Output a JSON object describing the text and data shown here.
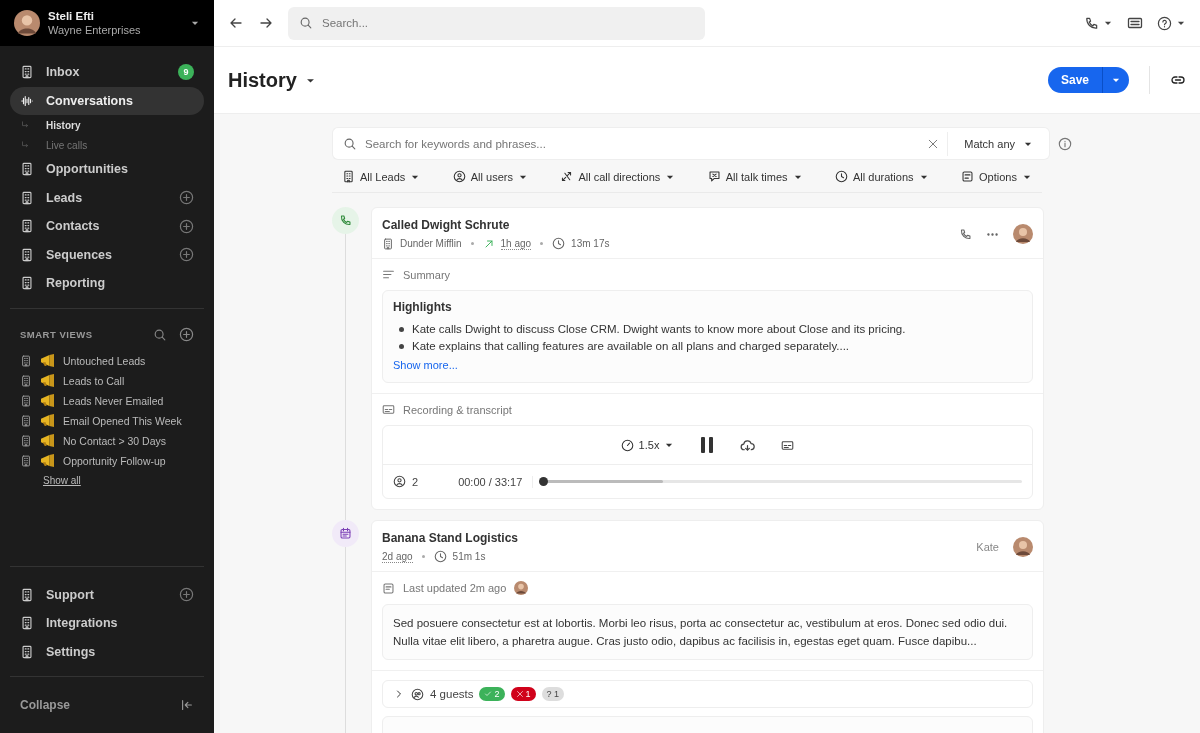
{
  "account": {
    "name": "Steli Efti",
    "company": "Wayne Enterprises"
  },
  "nav": [
    {
      "label": "Inbox",
      "kind": "building",
      "badge": "9",
      "add": false,
      "selected": false
    },
    {
      "label": "Conversations",
      "kind": "wave",
      "add": false,
      "selected": true,
      "children": [
        {
          "label": "History",
          "selected": true
        },
        {
          "label": "Live calls",
          "selected": false
        }
      ]
    },
    {
      "label": "Opportunities",
      "kind": "building",
      "add": false,
      "selected": false
    },
    {
      "label": "Leads",
      "kind": "building",
      "add": true,
      "selected": false
    },
    {
      "label": "Contacts",
      "kind": "building",
      "add": true,
      "selected": false
    },
    {
      "label": "Sequences",
      "kind": "building",
      "add": true,
      "selected": false
    },
    {
      "label": "Reporting",
      "kind": "building",
      "add": false,
      "selected": false
    }
  ],
  "smart_views": {
    "title": "SMART VIEWS",
    "items": [
      "Untouched Leads",
      "Leads to Call",
      "Leads Never Emailed",
      "Email Opened This Week",
      "No Contact > 30 Days",
      "Opportunity Follow-up"
    ],
    "show_all": "Show all"
  },
  "bottom_nav": [
    {
      "label": "Support",
      "add": true
    },
    {
      "label": "Integrations",
      "add": false
    },
    {
      "label": "Settings",
      "add": false
    }
  ],
  "collapse": "Collapse",
  "topbar": {
    "search_placeholder": "Search..."
  },
  "page": {
    "title": "History",
    "save": "Save"
  },
  "filter": {
    "placeholder": "Search for keywords and phrases...",
    "match": "Match any",
    "chips": [
      {
        "kind": "leads",
        "label": "All Leads"
      },
      {
        "kind": "users",
        "label": "All users"
      },
      {
        "kind": "directions",
        "label": "All call directions"
      },
      {
        "kind": "talk_times",
        "label": "All talk times"
      },
      {
        "kind": "durations",
        "label": "All durations"
      },
      {
        "kind": "options",
        "label": "Options"
      }
    ]
  },
  "call": {
    "title": "Called Dwight Schrute",
    "company": "Dunder Mifflin",
    "when": "1h ago",
    "duration": "13m 17s",
    "summary_label": "Summary",
    "highlights_title": "Highlights",
    "highlights": [
      "Kate calls Dwight to discuss Close CRM. Dwight wants to know more about Close and its pricing.",
      "Kate explains that calling features are available on all plans and charged separately...."
    ],
    "show_more": "Show more...",
    "recording_label": "Recording & transcript",
    "speed": "1.5x",
    "speakers": "2",
    "time": "00:00 / 33:17",
    "level": 0.25
  },
  "meeting": {
    "title": "Banana Stand Logistics",
    "user": "Kate",
    "when": "2d ago",
    "duration": "51m 1s",
    "updated": "Last updated 2m ago",
    "note": "Sed posuere consectetur est at lobortis. Morbi leo risus, porta ac consectetur ac, vestibulum at eros. Donec sed odio dui. Nulla vitae elit libero, a pharetra augue. Cras justo odio, dapibus ac facilisis in, egestas eget quam. Fusce dapibu...",
    "guests": "4 guests",
    "expanded": false,
    "responses": [
      {
        "kind": "yes",
        "count": "2"
      },
      {
        "kind": "no",
        "count": "1"
      },
      {
        "kind": "maybe",
        "symbol": "?",
        "count": "1"
      }
    ]
  }
}
